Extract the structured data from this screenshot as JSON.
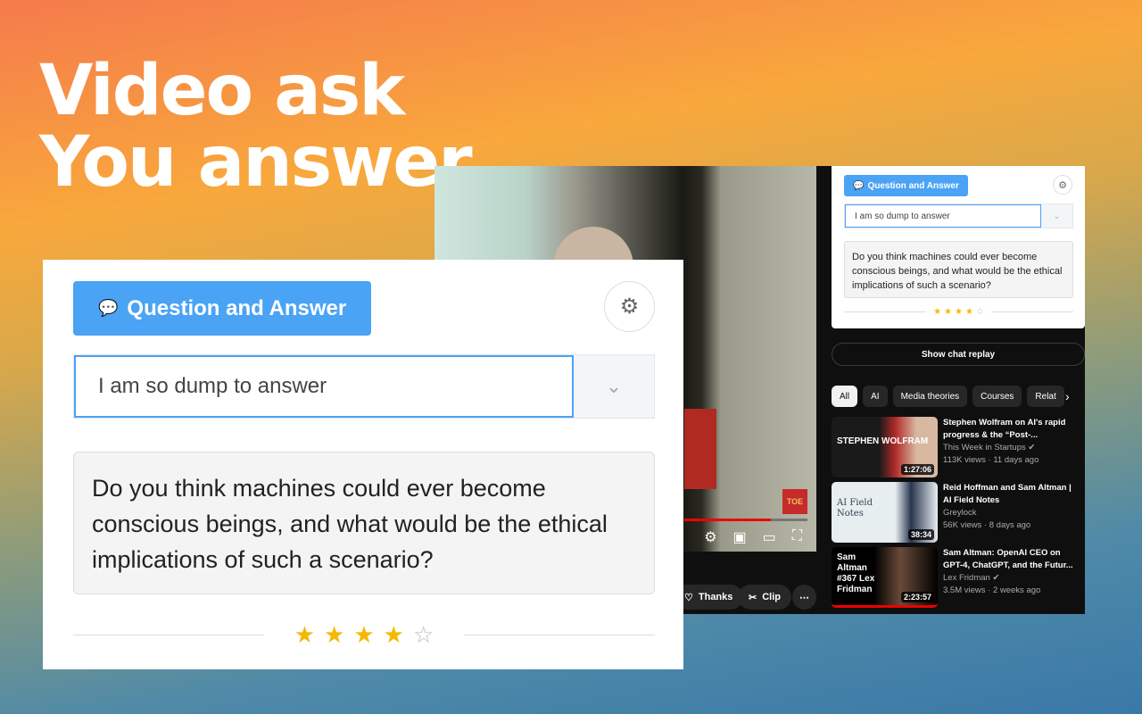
{
  "headline": {
    "line1": "Video ask",
    "line2": "You answer"
  },
  "video": {
    "watermark": "TOE",
    "progress_percent": 70,
    "actions": {
      "thanks": "Thanks",
      "clip": "Clip",
      "more": "⋯"
    }
  },
  "widget": {
    "button_label": "Question and Answer",
    "input_value": "I am so dump to answer",
    "question": "Do you think machines could ever become conscious beings, and what would be the ethical implications of such a scenario?",
    "rating": 4,
    "rating_max": 5,
    "accent": "#4aa3f5"
  },
  "sidebar": {
    "chat_replay": "Show chat replay",
    "chips": [
      "All",
      "AI",
      "Media theories",
      "Courses",
      "Relat"
    ],
    "videos": [
      {
        "title1": "Stephen Wolfram on AI's rapid",
        "title2": "progress & the “Post-...",
        "channel": "This Week in Startups",
        "verified": true,
        "stats": "113K views · 11 days ago",
        "duration": "1:27:06",
        "thumb_text": "STEPHEN WOLFRAM"
      },
      {
        "title1": "Reid Hoffman and Sam Altman |",
        "title2": "AI Field Notes",
        "channel": "Greylock",
        "verified": false,
        "stats": "56K views · 8 days ago",
        "duration": "38:34",
        "thumb_text": "AI Field Notes"
      },
      {
        "title1": "Sam Altman: OpenAI CEO on",
        "title2": "GPT-4, ChatGPT, and the Futur...",
        "channel": "Lex Fridman",
        "verified": true,
        "stats": "3.5M views · 2 weeks ago",
        "duration": "2:23:57",
        "thumb_text": "Sam Altman #367 Lex Fridman"
      }
    ]
  }
}
